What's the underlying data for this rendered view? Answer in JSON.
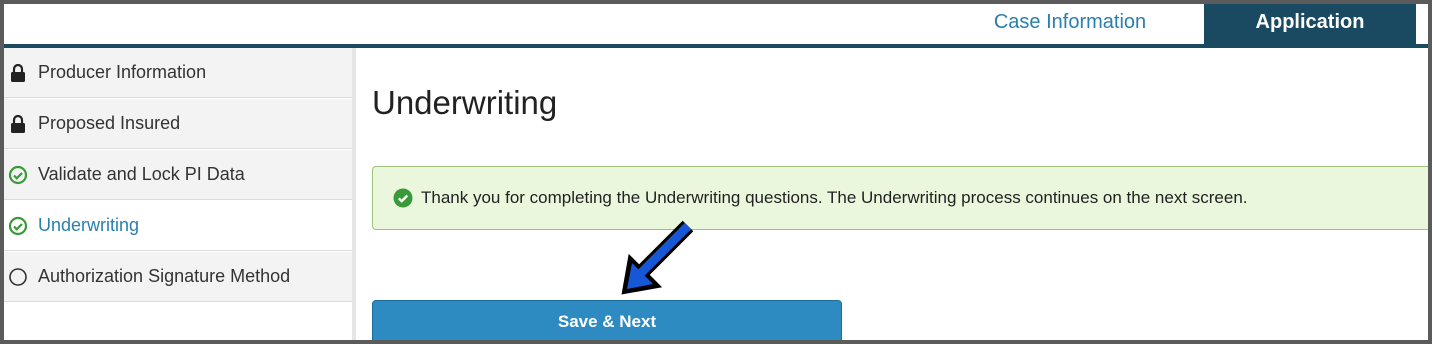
{
  "tabs": {
    "case_information": "Case Information",
    "application": "Application"
  },
  "sidebar": {
    "items": [
      {
        "label": "Producer Information",
        "icon": "lock-icon"
      },
      {
        "label": "Proposed Insured",
        "icon": "lock-icon"
      },
      {
        "label": "Validate and Lock PI Data",
        "icon": "check-circle-icon"
      },
      {
        "label": "Underwriting",
        "icon": "check-circle-icon",
        "active": true
      },
      {
        "label": "Authorization Signature Method",
        "icon": "empty-circle-icon"
      }
    ]
  },
  "main": {
    "title": "Underwriting",
    "alert_message": "Thank you for completing the Underwriting questions. The Underwriting process continues on the next screen.",
    "save_next_label": "Save & Next"
  },
  "colors": {
    "accent": "#2a7fae",
    "dark_tab": "#1a4a62",
    "success": "#3a9a3a",
    "alert_bg": "#eaf7dc",
    "button": "#2e8bc2",
    "annotation_arrow": "#1657d8"
  }
}
